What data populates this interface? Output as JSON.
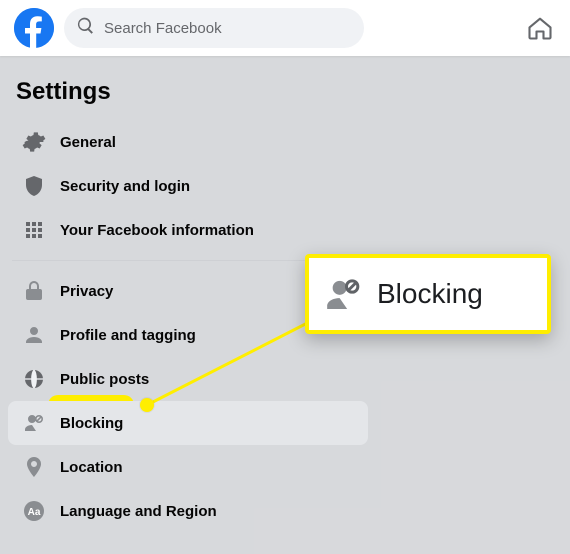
{
  "header": {
    "search_placeholder": "Search Facebook"
  },
  "page_title": "Settings",
  "menu": {
    "group1": [
      {
        "label": "General"
      },
      {
        "label": "Security and login"
      },
      {
        "label": "Your Facebook information"
      }
    ],
    "group2": [
      {
        "label": "Privacy"
      },
      {
        "label": "Profile and tagging"
      },
      {
        "label": "Public posts"
      },
      {
        "label": "Blocking"
      },
      {
        "label": "Location"
      },
      {
        "label": "Language and Region"
      }
    ]
  },
  "callout": {
    "label": "Blocking"
  },
  "annotation": {
    "highlight_color": "#ffee00",
    "accent_color": "#1877f2"
  }
}
